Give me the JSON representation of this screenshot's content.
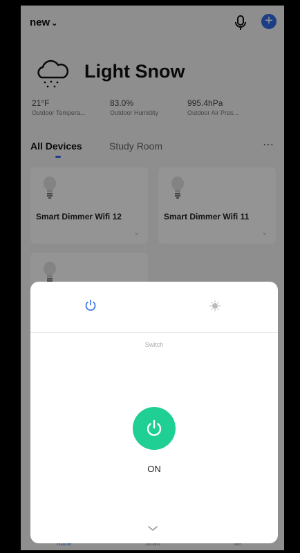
{
  "header": {
    "home_name": "new"
  },
  "weather": {
    "condition": "Light Snow",
    "stats": [
      {
        "value": "21°F",
        "label": "Outdoor Tempera..."
      },
      {
        "value": "83.0%",
        "label": "Outdoor Humidity"
      },
      {
        "value": "995.4hPa",
        "label": "Outdoor Air Pres..."
      }
    ]
  },
  "tabs": {
    "all": "All Devices",
    "room": "Study Room"
  },
  "devices": [
    {
      "name": "Smart Dimmer Wifi 12"
    },
    {
      "name": "Smart Dimmer Wifi 11"
    },
    {
      "name": ""
    }
  ],
  "bottom_nav": [
    "Home",
    "Smart",
    "Me"
  ],
  "sheet": {
    "section_label": "Switch",
    "state": "ON"
  },
  "colors": {
    "accent": "#2f6be6",
    "power_on": "#1fcf93"
  }
}
